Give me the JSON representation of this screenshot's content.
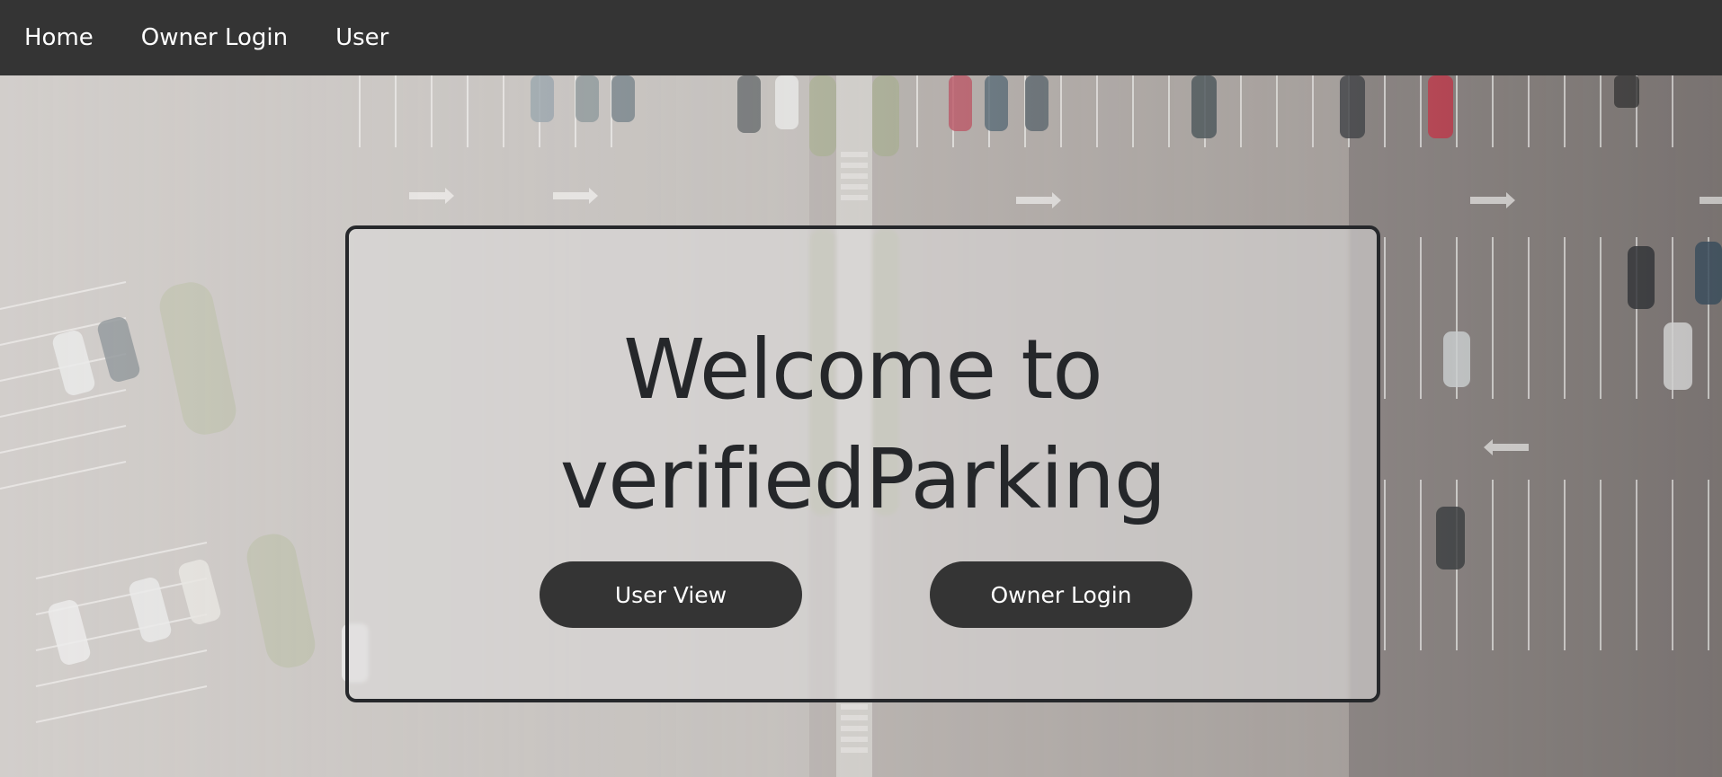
{
  "nav": {
    "items": [
      {
        "label": "Home"
      },
      {
        "label": "Owner Login"
      },
      {
        "label": "User"
      }
    ]
  },
  "hero": {
    "title_line1": "Welcome to",
    "title_line2": "verifiedParking",
    "user_view_button": "User View",
    "owner_login_button": "Owner Login"
  },
  "colors": {
    "navbar": "#343434",
    "button": "#343434",
    "title_text": "#25272a",
    "card_border": "#26282b"
  }
}
